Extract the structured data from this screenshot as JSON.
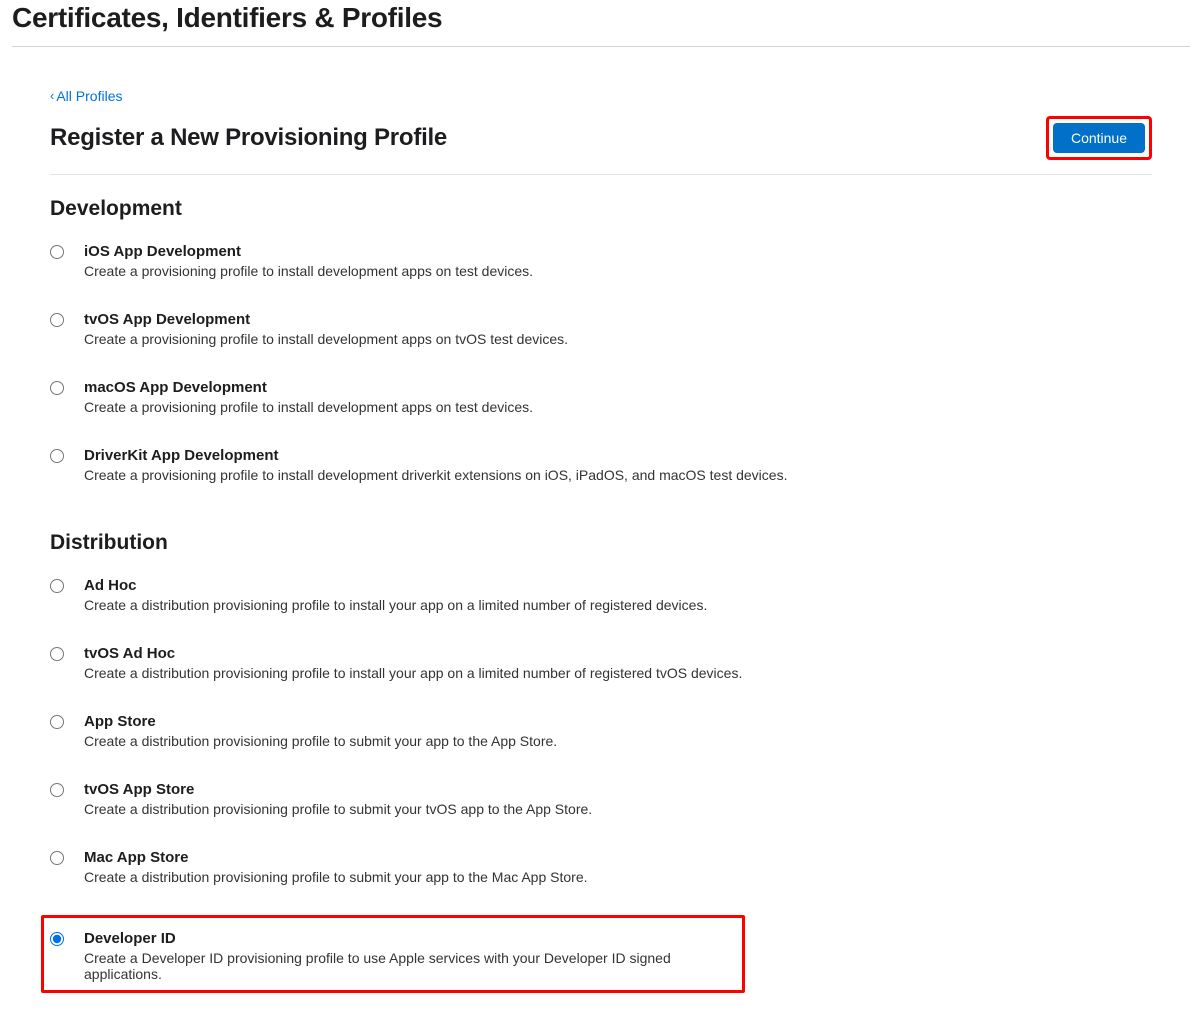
{
  "mainTitle": "Certificates, Identifiers & Profiles",
  "backLink": "All Profiles",
  "subTitle": "Register a New Provisioning Profile",
  "continueLabel": "Continue",
  "sections": {
    "development": {
      "heading": "Development",
      "options": [
        {
          "title": "iOS App Development",
          "desc": "Create a provisioning profile to install development apps on test devices.",
          "selected": false
        },
        {
          "title": "tvOS App Development",
          "desc": "Create a provisioning profile to install development apps on tvOS test devices.",
          "selected": false
        },
        {
          "title": "macOS App Development",
          "desc": "Create a provisioning profile to install development apps on test devices.",
          "selected": false
        },
        {
          "title": "DriverKit App Development",
          "desc": "Create a provisioning profile to install development driverkit extensions on iOS, iPadOS, and macOS test devices.",
          "selected": false
        }
      ]
    },
    "distribution": {
      "heading": "Distribution",
      "options": [
        {
          "title": "Ad Hoc",
          "desc": "Create a distribution provisioning profile to install your app on a limited number of registered devices.",
          "selected": false
        },
        {
          "title": "tvOS Ad Hoc",
          "desc": "Create a distribution provisioning profile to install your app on a limited number of registered tvOS devices.",
          "selected": false
        },
        {
          "title": "App Store",
          "desc": "Create a distribution provisioning profile to submit your app to the App Store.",
          "selected": false
        },
        {
          "title": "tvOS App Store",
          "desc": "Create a distribution provisioning profile to submit your tvOS app to the App Store.",
          "selected": false
        },
        {
          "title": "Mac App Store",
          "desc": "Create a distribution provisioning profile to submit your app to the Mac App Store.",
          "selected": false
        },
        {
          "title": "Developer ID",
          "desc": "Create a Developer ID provisioning profile to use Apple services with your Developer ID signed applications.",
          "selected": true
        }
      ]
    }
  }
}
